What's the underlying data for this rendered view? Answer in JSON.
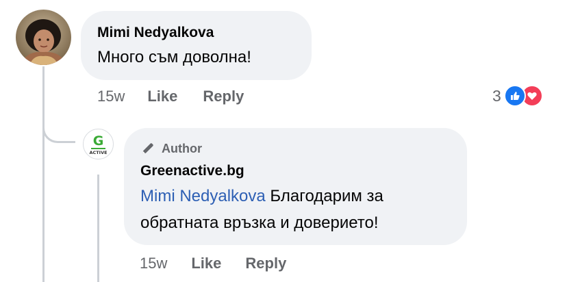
{
  "comment": {
    "author": "Mimi Nedyalkova",
    "text": "Много съм доволна!",
    "timestamp": "15w",
    "like_label": "Like",
    "reply_label": "Reply",
    "reaction_count": "3",
    "reactions": [
      "like-icon",
      "love-icon"
    ]
  },
  "reply": {
    "badge_label": "Author",
    "author": "Greenactive.bg",
    "mention": "Mimi Nedyalkova",
    "text": " Благодарим за обратната връзка и доверието!",
    "timestamp": "15w",
    "like_label": "Like",
    "reply_label": "Reply",
    "logo_text": "ACTIVE"
  },
  "colors": {
    "bubble_bg": "#f0f2f5",
    "mention": "#2d5fb4",
    "secondary_text": "#65676b",
    "like_blue": "#1877f2",
    "love_red": "#f33e58",
    "brand_green": "#3aaa35"
  }
}
